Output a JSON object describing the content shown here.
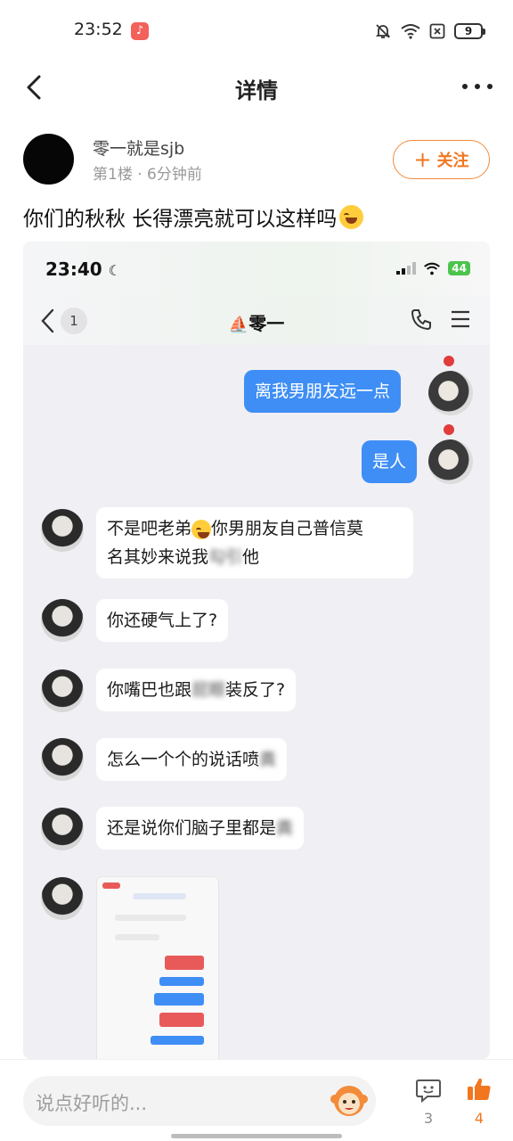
{
  "status_bar": {
    "time": "23:52",
    "app_icon": "music-note-icon",
    "icons": [
      "bell-off-icon",
      "wifi-icon",
      "no-sim-icon"
    ],
    "battery": "9"
  },
  "topbar": {
    "title": "详情",
    "back_icon": "chevron-left-icon",
    "more_icon": "more-icon"
  },
  "author": {
    "name": "零一就是sjb",
    "floor": "第1楼",
    "separator": "·",
    "time_ago": "6分钟前",
    "follow_label": "关注",
    "follow_prefix": "+"
  },
  "post": {
    "text": "你们的秋秋 长得漂亮就可以这样吗",
    "emoji": "laughing-emoji"
  },
  "screenshot": {
    "status_time": "23:40",
    "battery": "44",
    "nav": {
      "unread_count": "1",
      "title": "零一"
    },
    "messages": [
      {
        "side": "me",
        "text": "离我男朋友远一点"
      },
      {
        "side": "me",
        "text": "是人"
      },
      {
        "side": "other",
        "text_part1": "不是吧老弟",
        "text_part2": "你男朋友自己普信莫",
        "text_line2_visible": "名其妙来说我",
        "text_line2_blurred": "勾引",
        "text_line2_end": "他"
      },
      {
        "side": "other",
        "text": "你还硬气上了?"
      },
      {
        "side": "other",
        "text_visible": "你嘴巴也跟",
        "text_blurred": "屁眼",
        "text_end": "装反了?"
      },
      {
        "side": "other",
        "text_visible": "怎么一个个的说话喷",
        "text_blurred": "粪"
      },
      {
        "side": "other",
        "text_visible": "还是说你们脑子里都是",
        "text_blurred": "粪"
      }
    ]
  },
  "bottom_bar": {
    "comment_placeholder": "说点好听的...",
    "comment_count": "3",
    "like_count": "4"
  },
  "colors": {
    "accent": "#f1761f",
    "bubble_me": "#3f8ef5",
    "chat_bg": "#f0f0f4"
  }
}
